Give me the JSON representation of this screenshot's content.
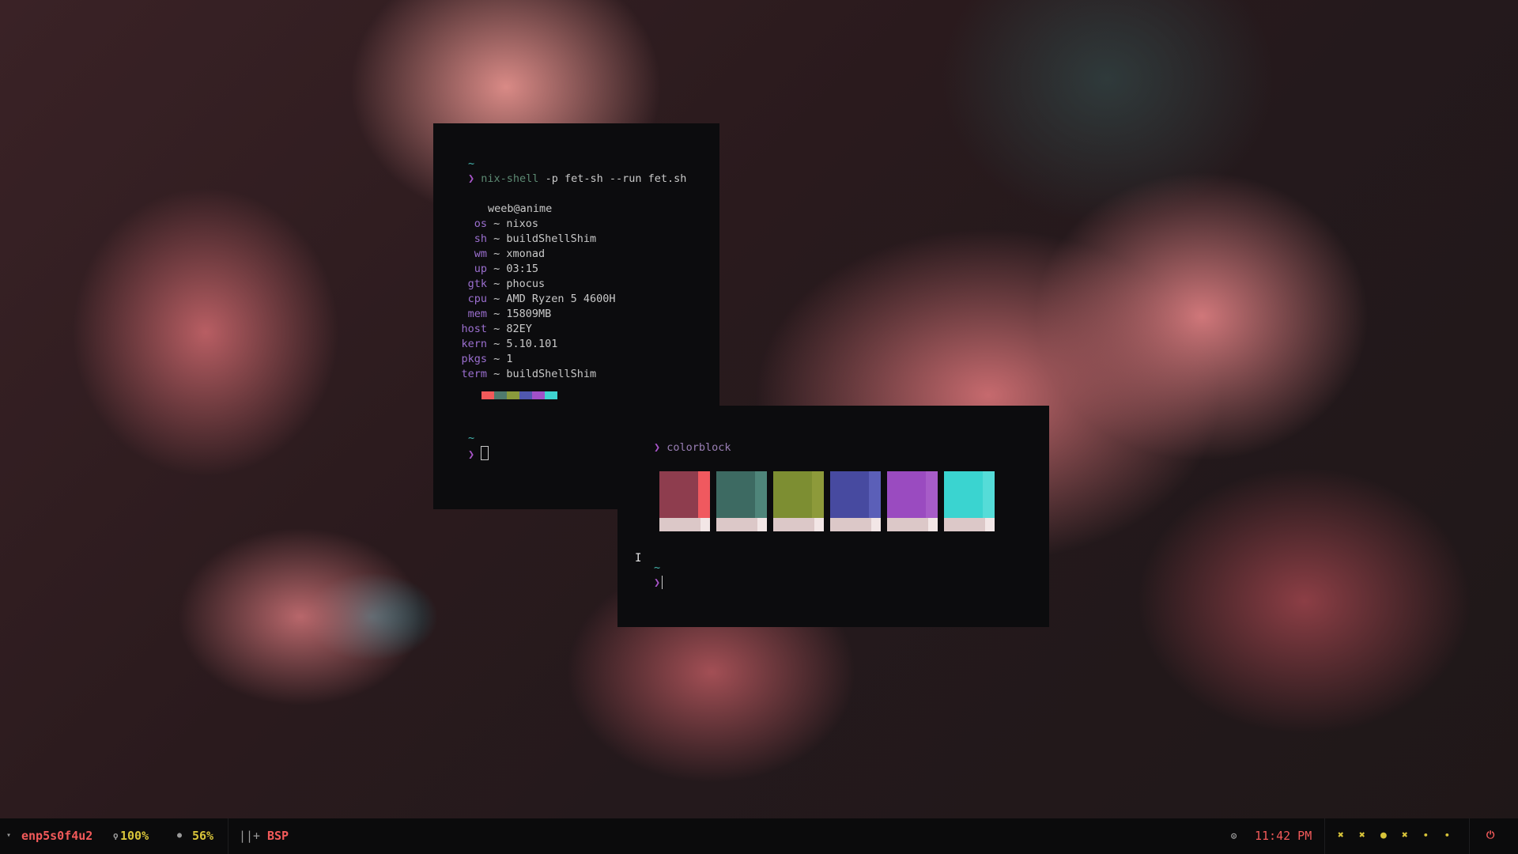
{
  "terminal1": {
    "tilde1": "~",
    "prompt_symbol": "❯",
    "command": "nix-shell",
    "command_args": " -p fet-sh --run fet.sh",
    "user_host": "weeb@anime",
    "info": [
      {
        "key": "os",
        "sep": " ~ ",
        "value": "nixos"
      },
      {
        "key": "sh",
        "sep": " ~ ",
        "value": "buildShellShim"
      },
      {
        "key": "wm",
        "sep": " ~ ",
        "value": "xmonad"
      },
      {
        "key": "up",
        "sep": " ~ ",
        "value": "03:15"
      },
      {
        "key": "gtk",
        "sep": " ~ ",
        "value": "phocus"
      },
      {
        "key": "cpu",
        "sep": " ~ ",
        "value": "AMD Ryzen 5 4600H"
      },
      {
        "key": "mem",
        "sep": " ~ ",
        "value": "15809MB"
      },
      {
        "key": "host",
        "sep": " ~ ",
        "value": "82EY"
      },
      {
        "key": "kern",
        "sep": " ~ ",
        "value": "5.10.101"
      },
      {
        "key": "pkgs",
        "sep": " ~ ",
        "value": "1"
      },
      {
        "key": "term",
        "sep": " ~ ",
        "value": "buildShellShim"
      }
    ],
    "palette_colors": [
      "#f25a5a",
      "#4f7a6e",
      "#8a9a3c",
      "#5058b0",
      "#a050c8",
      "#3ed4d0"
    ],
    "tilde2": "~",
    "prompt_symbol2": "❯"
  },
  "terminal2": {
    "prompt_symbol": "❯",
    "command": "colorblock",
    "blocks": [
      {
        "base": "#8e3d4e",
        "bright": "#f0595f"
      },
      {
        "base": "#3d6a62",
        "bright": "#4f857a"
      },
      {
        "base": "#7d8e32",
        "bright": "#8d9a3a"
      },
      {
        "base": "#474aa0",
        "bright": "#5b5fb8"
      },
      {
        "base": "#9a4bc0",
        "bright": "#a75cc8"
      },
      {
        "base": "#3ad4d0",
        "bright": "#55dcd8"
      }
    ],
    "tilde": "~",
    "prompt_symbol2": "❯"
  },
  "statusbar": {
    "network_icon": "wifi-icon",
    "network": "enp5s0f4u2",
    "battery_icon": "battery-icon",
    "battery": "100%",
    "brightness_icon": "brightness-icon",
    "brightness": "56%",
    "layout_symbol": "||+",
    "layout": "BSP",
    "clock_icon": "clock-icon",
    "time": "11:42 PM",
    "workspaces": [
      "✖",
      "✖",
      "●",
      "✖",
      "•",
      "•"
    ],
    "power_icon": "power-icon",
    "power_glyph": "⏻"
  }
}
